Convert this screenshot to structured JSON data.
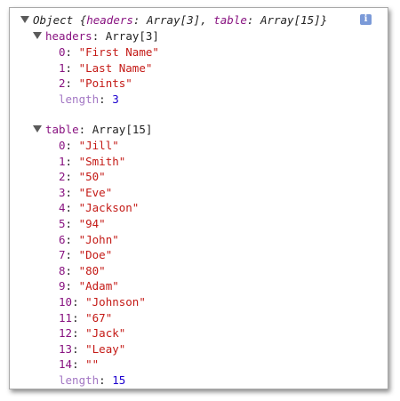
{
  "root": {
    "label": "Object",
    "preview_open": "{",
    "preview_close": "}",
    "preview_items": [
      {
        "key": "headers",
        "value": "Array[3]"
      },
      {
        "key": "table",
        "value": "Array[15]"
      }
    ],
    "info_icon_glyph": "i"
  },
  "headers": {
    "key": "headers",
    "type_label": "Array[3]",
    "items": [
      {
        "index": "0",
        "value": "\"First Name\""
      },
      {
        "index": "1",
        "value": "\"Last Name\""
      },
      {
        "index": "2",
        "value": "\"Points\""
      }
    ],
    "length_key": "length",
    "length_value": "3"
  },
  "table": {
    "key": "table",
    "type_label": "Array[15]",
    "items": [
      {
        "index": "0",
        "value": "\"Jill\""
      },
      {
        "index": "1",
        "value": "\"Smith\""
      },
      {
        "index": "2",
        "value": "\"50\""
      },
      {
        "index": "3",
        "value": "\"Eve\""
      },
      {
        "index": "4",
        "value": "\"Jackson\""
      },
      {
        "index": "5",
        "value": "\"94\""
      },
      {
        "index": "6",
        "value": "\"John\""
      },
      {
        "index": "7",
        "value": "\"Doe\""
      },
      {
        "index": "8",
        "value": "\"80\""
      },
      {
        "index": "9",
        "value": "\"Adam\""
      },
      {
        "index": "10",
        "value": "\"Johnson\""
      },
      {
        "index": "11",
        "value": "\"67\""
      },
      {
        "index": "12",
        "value": "\"Jack\""
      },
      {
        "index": "13",
        "value": "\"Leay\""
      },
      {
        "index": "14",
        "value": "\"\""
      }
    ],
    "length_key": "length",
    "length_value": "15"
  },
  "colors": {
    "property_key": "#881280",
    "length_key": "#a377c4",
    "string_value": "#c41a16",
    "number_value": "#1c00cf",
    "info_icon_bg": "#7b9ad8"
  }
}
